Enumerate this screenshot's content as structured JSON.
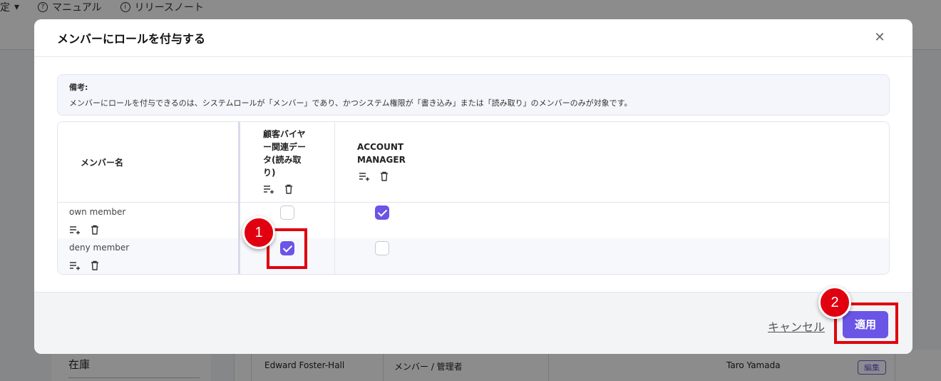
{
  "background": {
    "nav": {
      "settings_fragment": "定",
      "manual": "マニュアル",
      "release_notes": "リリースノート"
    },
    "sidebar_item": "在庫",
    "row": {
      "name": "Edward Foster-Hall",
      "role": "メンバー / 管理者",
      "manager": "Taro Yamada",
      "edit": "編集"
    }
  },
  "modal": {
    "title": "メンバーにロールを付与する",
    "note": {
      "title": "備考:",
      "text": "メンバーにロールを付与できるのは、システムロールが「メンバー」であり、かつシステム権限が「書き込み」または「読み取り」のメンバーのみが対象です。"
    },
    "table": {
      "name_header": "メンバー名",
      "roles": [
        {
          "line1": "顧客バイヤ",
          "line2": "ー関連デー",
          "line3": "タ(読み取",
          "line4": "り)"
        },
        {
          "line1": "ACCOUNT",
          "line2": "MANAGER"
        }
      ],
      "members": [
        {
          "name": "own member",
          "checks": [
            false,
            true
          ]
        },
        {
          "name": "deny member",
          "checks": [
            true,
            false
          ]
        }
      ]
    },
    "footer": {
      "cancel": "キャンセル",
      "apply": "適用"
    }
  },
  "annotations": {
    "step1": "1",
    "step2": "2"
  },
  "colors": {
    "accent": "#6a55e6",
    "highlight": "#e0000f"
  }
}
